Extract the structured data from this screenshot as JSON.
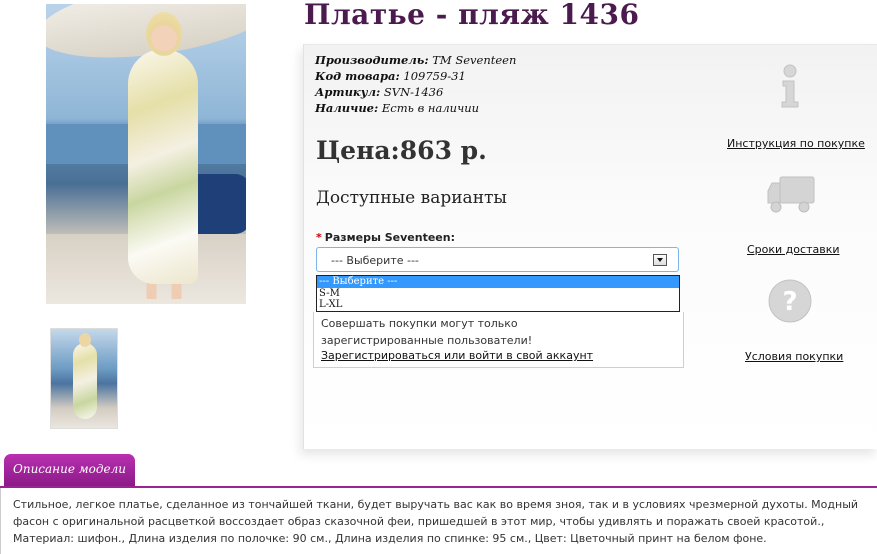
{
  "product": {
    "title": "Платье - пляж 1436",
    "manufacturer_label": "Производитель:",
    "manufacturer_value": "TM Seventeen",
    "code_label": "Код товара:",
    "code_value": "109759-31",
    "sku_label": "Артикул:",
    "sku_value": "SVN-1436",
    "stock_label": "Наличие:",
    "stock_value": "Есть в наличии",
    "price": "Цена:863 р."
  },
  "variants": {
    "heading": "Доступные варианты",
    "size_label": "Размеры Seventeen:",
    "required_mark": "*",
    "select_value": "--- Выберите ---",
    "options": [
      "--- Выберите ---",
      "S-M",
      "L-XL"
    ]
  },
  "notice": {
    "message": "Совершать покупки могут только зарегистрированные пользователи!",
    "register_link": "Зарегистрироваться или войти в свой аккаунт"
  },
  "sidebar": {
    "instruction_link": "Инструкция по покупке",
    "delivery_link": "Сроки доставки",
    "terms_link": "Условия покупки"
  },
  "tabs": {
    "description_label": "Описание модели"
  },
  "description": "Стильное, легкое платье, сделанное из тончайшей ткани, будет выручать вас как во время зноя, так и в условиях чрезмерной духоты. Модный фасон с оригинальной расцветкой воссоздает образ сказочной феи, пришедшей в этот мир, чтобы удивлять и поражать своей красотой., Материал: шифон., Длина изделия по полочке: 90 см., Длина изделия по спинке: 95 см., Цвет: Цветочный принт на белом фоне.",
  "colors": {
    "title": "#4b1a4e",
    "tab": "#9b2495",
    "selected_option": "#3399ff",
    "required": "#cc0000"
  }
}
